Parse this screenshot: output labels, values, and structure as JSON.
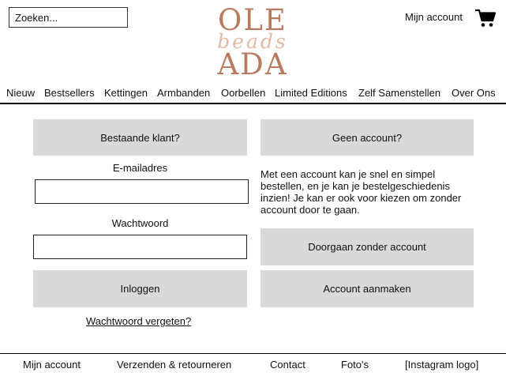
{
  "header": {
    "search_placeholder": "Zoeken...",
    "logo": {
      "line1": "OLE",
      "script": "beads",
      "line2": "ADA"
    },
    "account_label": "Mijn account",
    "cart_icon": "shopping-cart-icon"
  },
  "nav": {
    "items": [
      "Nieuw",
      "Bestsellers",
      "Kettingen",
      "Armbanden",
      "Oorbellen",
      "Limited Editions",
      "Zelf Samenstellen",
      "Over Ons"
    ]
  },
  "login": {
    "heading": "Bestaande klant?",
    "email_label": "E-mailadres",
    "email_value": "",
    "password_label": "Wachtwoord",
    "password_value": "",
    "login_button": "Inloggen",
    "forgot_link": "Wachtwoord vergeten?"
  },
  "guest": {
    "heading": "Geen account?",
    "description": "Met een account kan je snel en simpel bestellen, en je kan je bestelgeschiedenis inzien! Je kan er ook voor kiezen om zonder account door te gaan.",
    "continue_button": "Doorgaan zonder account",
    "create_button": "Account aanmaken"
  },
  "footer": {
    "items": [
      "Mijn account",
      "Verzenden & retourneren",
      "Contact",
      "Foto's",
      "[Instagram logo]"
    ]
  },
  "colors": {
    "logo_primary": "#b97a5f",
    "logo_script": "#e3b9a6",
    "button_gray": "#d9d9d9"
  }
}
